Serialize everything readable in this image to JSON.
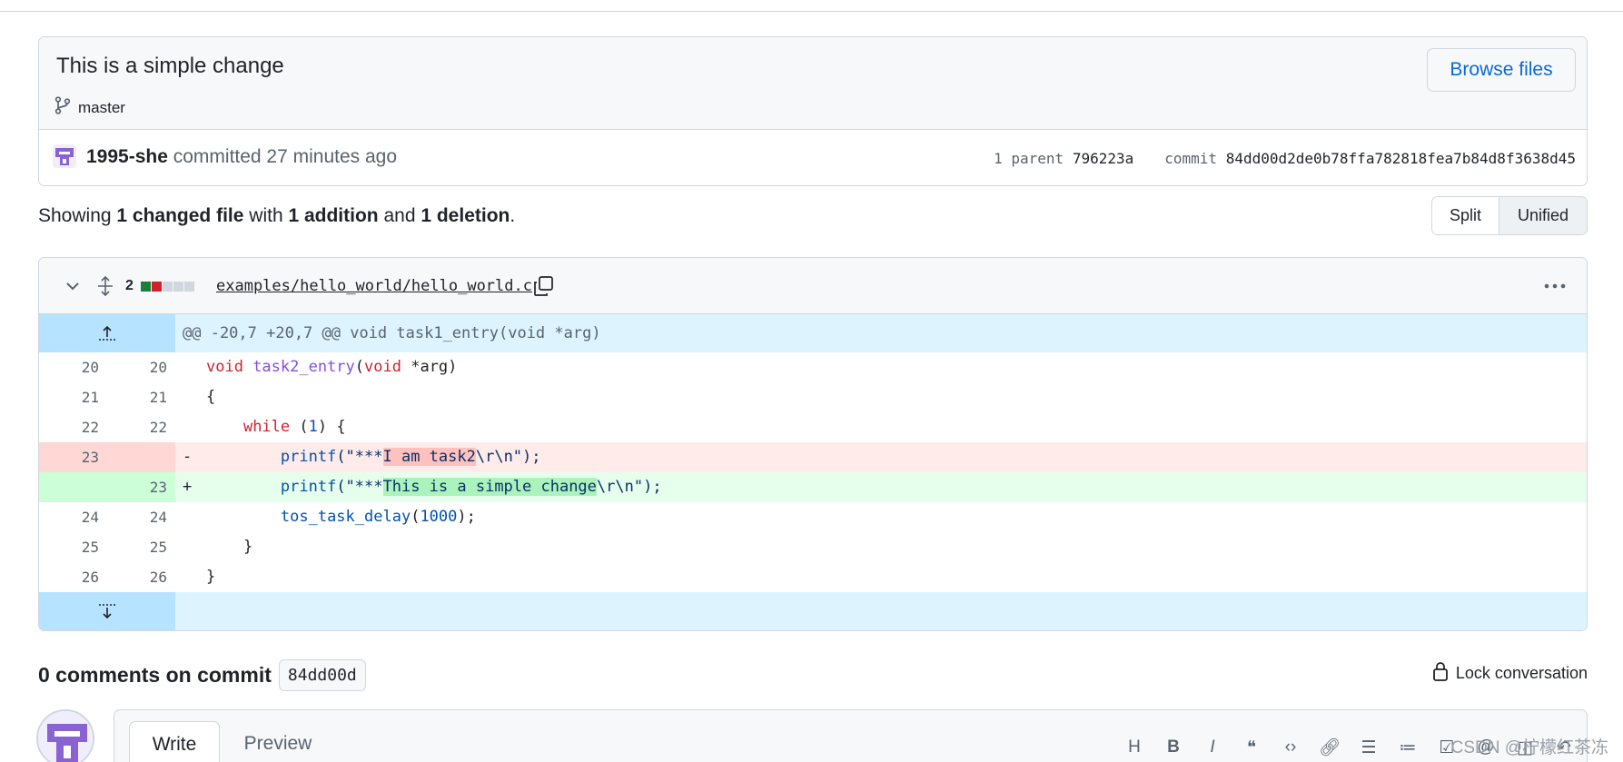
{
  "commit": {
    "title": "This is a simple change",
    "branch": "master",
    "browse_label": "Browse files",
    "author": "1995-she",
    "action": " committed 27 minutes ago",
    "parent_label": "1 parent",
    "parent_sha": "796223a",
    "commit_label": "commit",
    "commit_sha": "84dd00d2de0b78ffa782818fea7b84d8f3638d45"
  },
  "summary": {
    "prefix": "Showing ",
    "files": "1 changed file",
    "mid1": " with ",
    "additions": "1 addition",
    "mid2": " and ",
    "deletions": "1 deletion",
    "suffix": "."
  },
  "view_toggle": {
    "split": "Split",
    "unified": "Unified"
  },
  "file": {
    "change_count": "2",
    "path": "examples/hello_world/hello_world.c",
    "diffstat_colors": [
      "#1a7f37",
      "#cf222e",
      "#d0d7de",
      "#d0d7de",
      "#d0d7de"
    ],
    "hunk_header": "@@ -20,7 +20,7 @@ void task1_entry(void *arg)",
    "lines": [
      {
        "old": "20",
        "new": "20",
        "type": "context",
        "marker": ""
      },
      {
        "old": "21",
        "new": "21",
        "type": "context",
        "marker": ""
      },
      {
        "old": "22",
        "new": "22",
        "type": "context",
        "marker": ""
      },
      {
        "old": "23",
        "new": "",
        "type": "del",
        "marker": "-"
      },
      {
        "old": "",
        "new": "23",
        "type": "add",
        "marker": "+"
      },
      {
        "old": "24",
        "new": "24",
        "type": "context",
        "marker": ""
      },
      {
        "old": "25",
        "new": "25",
        "type": "context",
        "marker": ""
      },
      {
        "old": "26",
        "new": "26",
        "type": "context",
        "marker": ""
      }
    ],
    "code": {
      "l20_void": "void ",
      "l20_fn": "task2_entry",
      "l20_paren": "(",
      "l20_void2": "void",
      "l20_rest": " *arg)",
      "l21": "{",
      "l22_indent": "    ",
      "l22_while": "while",
      "l22_open": " (",
      "l22_num": "1",
      "l22_rest": ") {",
      "indent2": "        ",
      "printf": "printf",
      "del_pre": "(\"***",
      "del_hl": "I am task2",
      "del_post": "\\r\\n\");",
      "add_pre": "(\"***",
      "add_hl": "This is a simple change",
      "add_post": "\\r\\n\");",
      "l24_fn": "tos_task_delay",
      "l24_open": "(",
      "l24_num": "1000",
      "l24_rest": ");",
      "l25": "    }",
      "l26": "}"
    }
  },
  "comments": {
    "title": "0 comments on commit",
    "sha": "84dd00d",
    "lock_label": "Lock conversation"
  },
  "editor": {
    "write_tab": "Write",
    "preview_tab": "Preview",
    "toolbar_icons": [
      "heading-icon",
      "bold-icon",
      "italic-icon",
      "quote-icon",
      "code-icon",
      "link-icon",
      "unordered-list-icon",
      "ordered-list-icon",
      "task-list-icon",
      "mention-icon",
      "reference-icon",
      "undo-icon"
    ]
  },
  "watermark": "CSDN @柠檬红茶冻",
  "colors": {
    "accent": "#0969da",
    "hunk": "#ddf4ff",
    "del": "#ffebe9",
    "add": "#e6ffec",
    "avatar": "#8a63d2"
  }
}
